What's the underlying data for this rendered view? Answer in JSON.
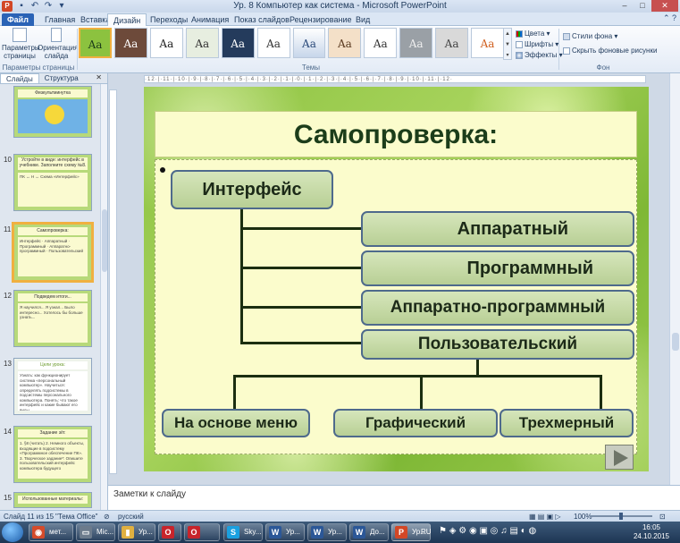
{
  "window": {
    "title": "Ур. 8 Компьютер как система - Microsoft PowerPoint",
    "controls": [
      "–",
      "□",
      "✕"
    ]
  },
  "tabs": {
    "file": "Файл",
    "items": [
      "Главная",
      "Вставка",
      "Дизайн",
      "Переходы",
      "Анимация",
      "Показ слайдов",
      "Рецензирование",
      "Вид"
    ],
    "active_index": 2
  },
  "ribbon": {
    "page_setup": {
      "btn1": "Параметры страницы",
      "btn2": "Ориентация слайда",
      "group": "Параметры страницы"
    },
    "themes": {
      "group": "Темы",
      "sample": "Aa"
    },
    "theme_opts": {
      "colors": "Цвета",
      "fonts": "Шрифты",
      "effects": "Эффекты"
    },
    "background": {
      "styles": "Стили фона",
      "hide": "Скрыть фоновые рисунки",
      "group": "Фон"
    }
  },
  "left_panel": {
    "tabs": [
      "Слайды",
      "Структура"
    ],
    "close": "✕",
    "slides": [
      {
        "num": "",
        "title": "Физкультминутка",
        "body": ""
      },
      {
        "num": "10",
        "title": "Устройте в виде: интерфейс в учебнике. Заполните схему №8.",
        "body": "ПК ↔ Н ↔ Схема «Интерфейс»"
      },
      {
        "num": "11",
        "title": "Самопроверка:",
        "body": "Интерфейс · Аппаратный · Программный · Аппаратно-программный · Пользовательский"
      },
      {
        "num": "12",
        "title": "Подведем итоги...",
        "body": "Я научился... Я узнал... Было интересно... Хотелось бы больше узнать..."
      },
      {
        "num": "13",
        "title": "Цели урока:",
        "body": "Узнать: как функционирует система «персональный компьютер». Научиться: определять подсистемы в подсистемы персонального компьютера. Понять: что такое интерфейс и какие бывают его виды."
      },
      {
        "num": "14",
        "title": "Задание з/п:",
        "body": "1. §8 (читать) 2. Немного объекты, входящие в подсистему «Программное обеспечение ПК». 3. Творческое задание*: Опишите пользовательский интерфейс компьютера будущего"
      },
      {
        "num": "15",
        "title": "Использованные материалы:",
        "body": ""
      }
    ]
  },
  "ruler": "·12·|·11·|·10·|·9·|·8·|·7·|·6·|·5·|·4·|·3·|·2·|·1·|·0·|·1·|·2·|·3·|·4·|·5·|·6·|·7·|·8·|·9·|·10·|·11·|·12·",
  "slide": {
    "title": "Самопроверка:",
    "root": "Интерфейс",
    "branches": [
      "Аппаратный",
      "Программный",
      "Аппаратно-программный",
      "Пользовательский"
    ],
    "leaves": [
      "На основе меню",
      "Графический",
      "Трехмерный"
    ]
  },
  "notes": {
    "placeholder": "Заметки к слайду"
  },
  "status": {
    "slide_info": "Слайд 11 из 15",
    "theme": "\"Тема Office\"",
    "language": "русский",
    "zoom": "100%"
  },
  "taskbar": {
    "items": [
      {
        "label": "мет...",
        "color": "#d44b2b",
        "glyph": "◉"
      },
      {
        "label": "Mic...",
        "color": "#6c7b8c",
        "glyph": "▭"
      },
      {
        "label": "Ур...",
        "color": "#e0b040",
        "glyph": "▮"
      },
      {
        "label": "",
        "color": "#c7242b",
        "glyph": "O"
      },
      {
        "label": "Sky...",
        "color": "#1aa0e0",
        "glyph": "S"
      },
      {
        "label": "Ур...",
        "color": "#2b5797",
        "glyph": "W"
      },
      {
        "label": "Ур...",
        "color": "#2b5797",
        "glyph": "W"
      },
      {
        "label": "До...",
        "color": "#2b5797",
        "glyph": "W"
      },
      {
        "label": "Ур...",
        "color": "#d24726",
        "glyph": "P"
      }
    ],
    "lang": "RU",
    "time": "16:05",
    "date": "24.10.2015"
  }
}
